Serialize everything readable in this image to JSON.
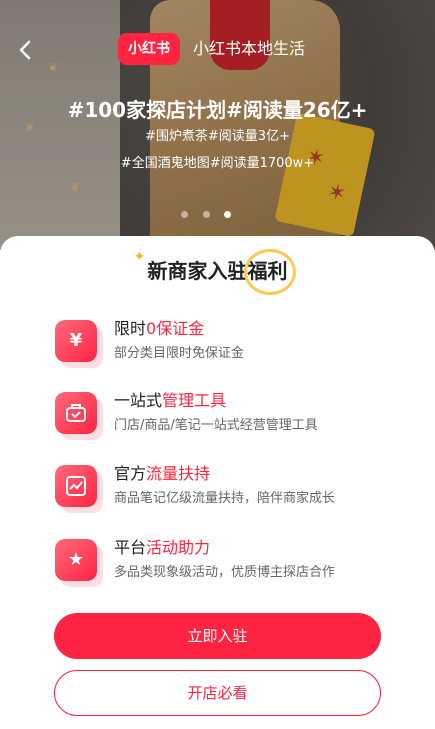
{
  "header": {
    "logo_text": "小红书",
    "site_title": "小红书本地生活",
    "back_icon": "chevron-left-icon"
  },
  "banner": {
    "headline": "#100家探店计划#阅读量26亿+",
    "tag_line_1": "#围炉煮茶#阅读量3亿+",
    "tag_line_2": "#全国酒鬼地图#阅读量1700w+",
    "carousel_pages": 3,
    "carousel_active": 2
  },
  "benefits": {
    "title": "新商家入驻福利",
    "items": [
      {
        "title_prefix": "限时",
        "title_highlight": "0保证金",
        "desc": "部分类目限时免保证金",
        "icon": "yen-icon"
      },
      {
        "title_prefix": "一站式",
        "title_highlight": "管理工具",
        "desc": "门店/商品/笔记一站式经营管理工具",
        "icon": "toolbox-icon"
      },
      {
        "title_prefix": "官方",
        "title_highlight": "流量扶持",
        "desc": "商品笔记亿级流量扶持，陪伴商家成长",
        "icon": "trend-icon"
      },
      {
        "title_prefix": "平台",
        "title_highlight": "活动助力",
        "desc": "多品类现象级活动，优质博主探店合作",
        "icon": "star-badge-icon"
      }
    ]
  },
  "actions": {
    "primary_label": "立即入驻",
    "secondary_label": "开店必看"
  },
  "colors": {
    "brand_red": "#ff2442",
    "highlight_yellow": "#ffc94d"
  }
}
